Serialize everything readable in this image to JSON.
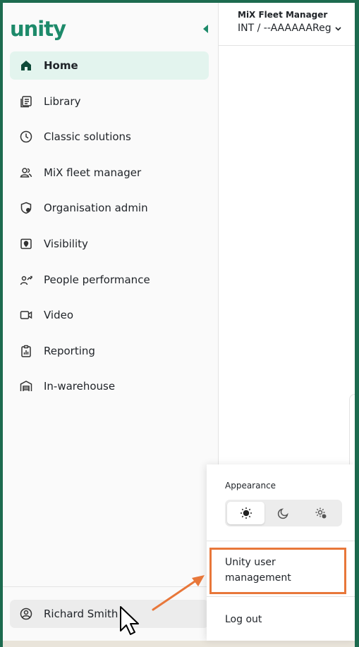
{
  "brand": {
    "logo_text": "unity",
    "color": "#1d8a6a"
  },
  "sidebar": {
    "items": [
      {
        "label": "Home",
        "icon": "home-icon",
        "active": true
      },
      {
        "label": "Library",
        "icon": "library-icon"
      },
      {
        "label": "Classic solutions",
        "icon": "clock-icon"
      },
      {
        "label": "MiX fleet manager",
        "icon": "users-icon"
      },
      {
        "label": "Organisation admin",
        "icon": "shield-user-icon"
      },
      {
        "label": "Visibility",
        "icon": "map-pin-icon"
      },
      {
        "label": "People performance",
        "icon": "performance-icon"
      },
      {
        "label": "Video",
        "icon": "video-icon"
      },
      {
        "label": "Reporting",
        "icon": "clipboard-chart-icon"
      },
      {
        "label": "In-warehouse",
        "icon": "warehouse-icon"
      }
    ],
    "user_name": "Richard Smith"
  },
  "header": {
    "org_title": "MiX Fleet Manager",
    "org_sub": "INT / --AAAAAAReg"
  },
  "popover": {
    "appearance_label": "Appearance",
    "theme_options": [
      "light",
      "dark",
      "system"
    ],
    "selected_theme": "light",
    "menu": {
      "user_management": "Unity user management",
      "log_out": "Log out"
    }
  },
  "annotation": {
    "color": "#e8773a"
  }
}
